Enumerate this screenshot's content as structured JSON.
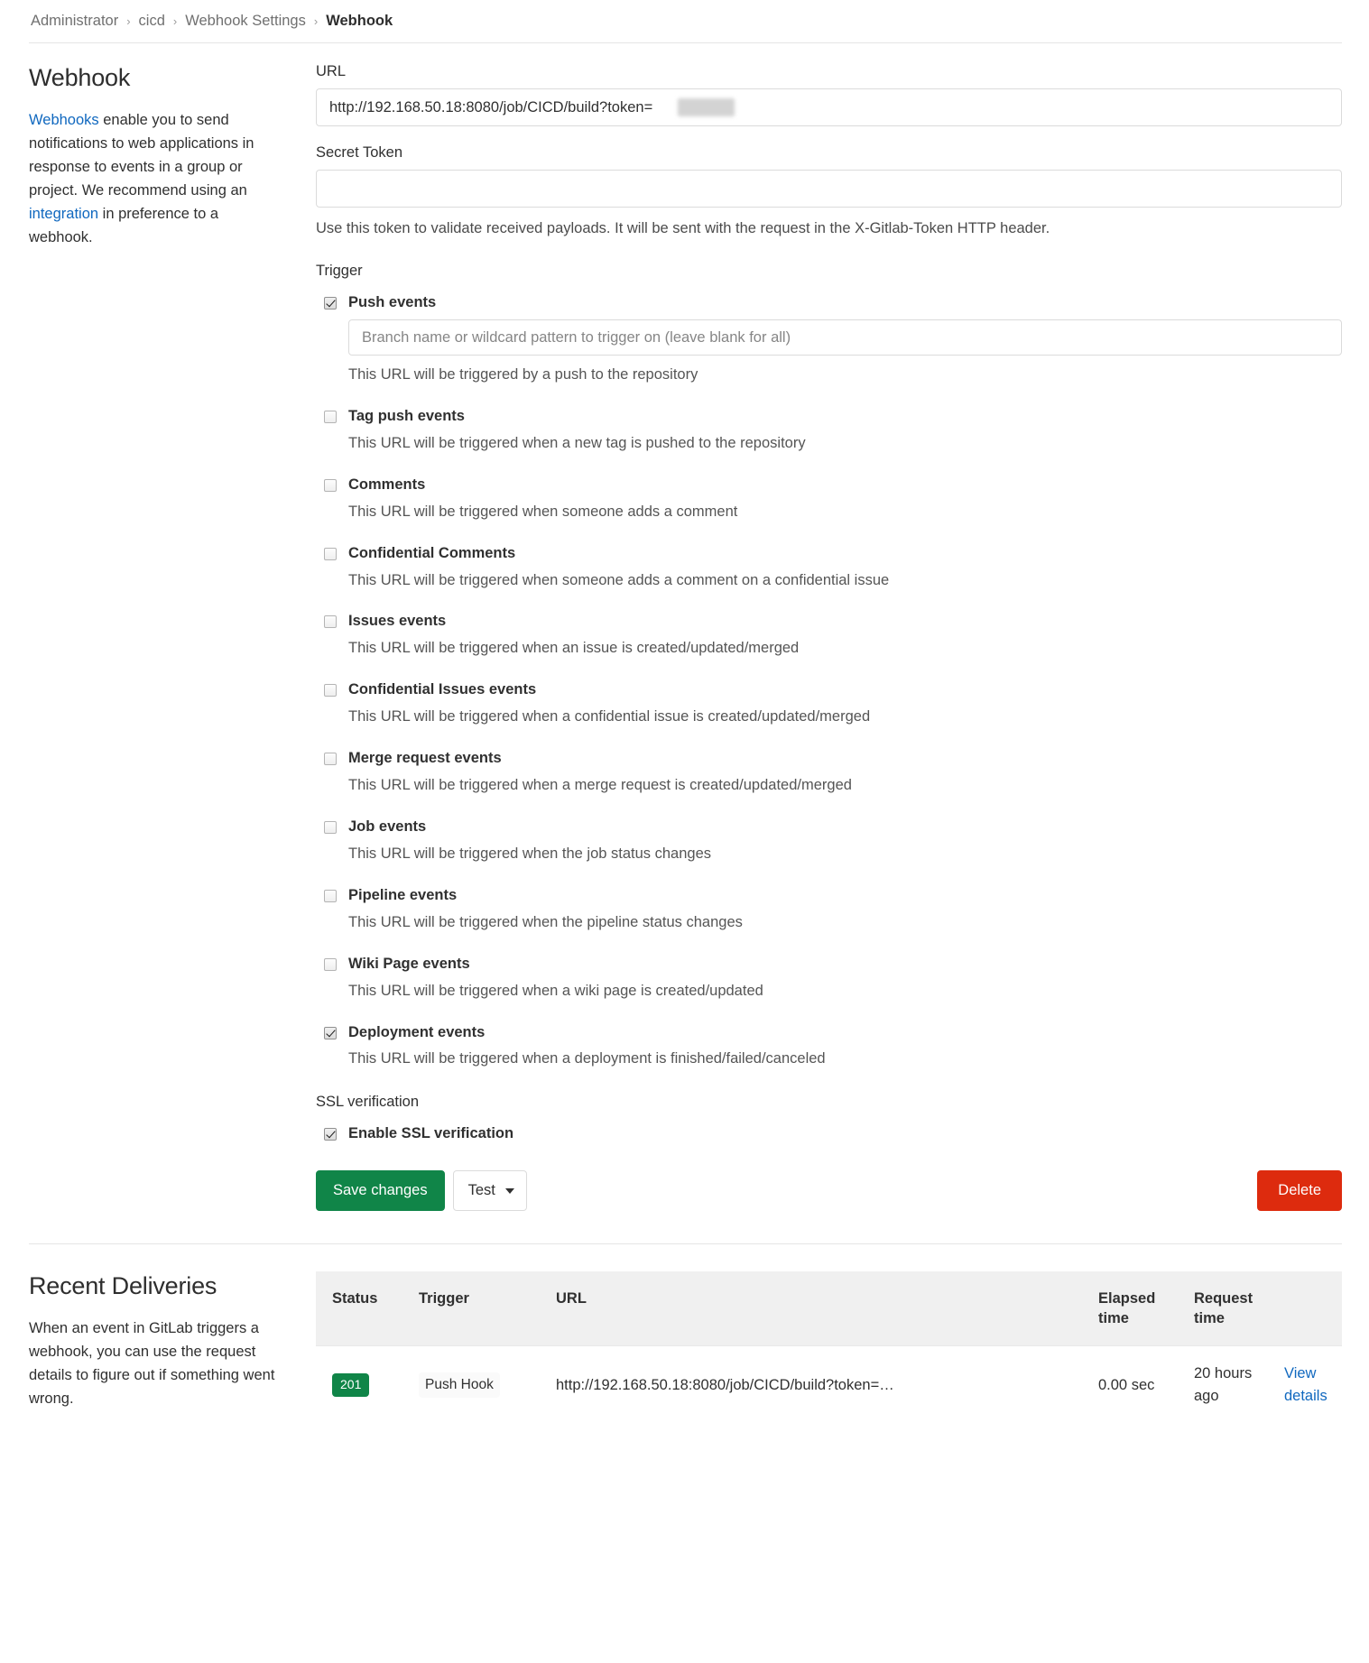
{
  "breadcrumb": {
    "items": [
      {
        "label": "Administrator",
        "current": false
      },
      {
        "label": "cicd",
        "current": false
      },
      {
        "label": "Webhook Settings",
        "current": false
      },
      {
        "label": "Webhook",
        "current": true
      }
    ],
    "separator": "›"
  },
  "webhook_section": {
    "title": "Webhook",
    "desc_link_1": "Webhooks",
    "desc_part_1": " enable you to send notifications to web applications in response to events in a group or project. We recommend using an ",
    "desc_link_2": "integration",
    "desc_part_2": " in preference to a webhook."
  },
  "form": {
    "url_label": "URL",
    "url_value": "http://192.168.50.18:8080/job/CICD/build?token=",
    "secret_token_label": "Secret Token",
    "secret_token_value": "",
    "secret_token_placeholder": "",
    "secret_token_help": "Use this token to validate received payloads. It will be sent with the request in the X-Gitlab-Token HTTP header."
  },
  "trigger": {
    "heading": "Trigger",
    "branch_placeholder": "Branch name or wildcard pattern to trigger on (leave blank for all)",
    "branch_value": "",
    "items": [
      {
        "label": "Push events",
        "checked": true,
        "description": "This URL will be triggered by a push to the repository",
        "has_branch_input": true
      },
      {
        "label": "Tag push events",
        "checked": false,
        "description": "This URL will be triggered when a new tag is pushed to the repository",
        "has_branch_input": false
      },
      {
        "label": "Comments",
        "checked": false,
        "description": "This URL will be triggered when someone adds a comment",
        "has_branch_input": false
      },
      {
        "label": "Confidential Comments",
        "checked": false,
        "description": "This URL will be triggered when someone adds a comment on a confidential issue",
        "has_branch_input": false
      },
      {
        "label": "Issues events",
        "checked": false,
        "description": "This URL will be triggered when an issue is created/updated/merged",
        "has_branch_input": false
      },
      {
        "label": "Confidential Issues events",
        "checked": false,
        "description": "This URL will be triggered when a confidential issue is created/updated/merged",
        "has_branch_input": false
      },
      {
        "label": "Merge request events",
        "checked": false,
        "description": "This URL will be triggered when a merge request is created/updated/merged",
        "has_branch_input": false
      },
      {
        "label": "Job events",
        "checked": false,
        "description": "This URL will be triggered when the job status changes",
        "has_branch_input": false
      },
      {
        "label": "Pipeline events",
        "checked": false,
        "description": "This URL will be triggered when the pipeline status changes",
        "has_branch_input": false
      },
      {
        "label": "Wiki Page events",
        "checked": false,
        "description": "This URL will be triggered when a wiki page is created/updated",
        "has_branch_input": false
      },
      {
        "label": "Deployment events",
        "checked": true,
        "description": "This URL will be triggered when a deployment is finished/failed/canceled",
        "has_branch_input": false
      }
    ]
  },
  "ssl": {
    "heading": "SSL verification",
    "checkbox_label": "Enable SSL verification",
    "checked": true
  },
  "actions": {
    "save_label": "Save changes",
    "test_label": "Test",
    "delete_label": "Delete",
    "save_color": "#108548",
    "delete_color": "#dd2b0e"
  },
  "recent_deliveries": {
    "title": "Recent Deliveries",
    "description": "When an event in GitLab triggers a webhook, you can use the request details to figure out if something went wrong.",
    "columns": [
      "Status",
      "Trigger",
      "URL",
      "Elapsed time",
      "Request time",
      ""
    ],
    "rows": [
      {
        "status": "201",
        "status_color": "#108548",
        "trigger": "Push Hook",
        "url": "http://192.168.50.18:8080/job/CICD/build?token=…",
        "elapsed_time": "0.00 sec",
        "request_time": "20 hours ago",
        "action_label": "View details"
      }
    ]
  }
}
